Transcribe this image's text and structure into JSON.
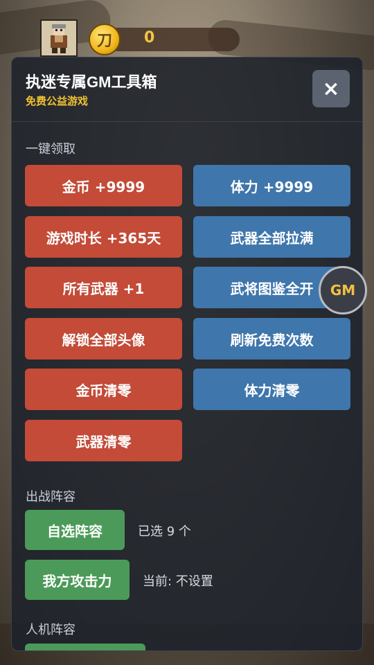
{
  "hud": {
    "coin_icon_glyph": "刀",
    "coin_value": "0"
  },
  "panel": {
    "title": "执迷专属GM工具箱",
    "subtitle": "免费公益游戏",
    "close_label": "×"
  },
  "section_one_click": {
    "title": "一键领取",
    "buttons": [
      {
        "label": "金币 +9999",
        "color": "#c34b38"
      },
      {
        "label": "体力 +9999",
        "color": "#3f76ac"
      },
      {
        "label": "游戏时长 +365天",
        "color": "#c34b38"
      },
      {
        "label": "武器全部拉满",
        "color": "#3f76ac"
      },
      {
        "label": "所有武器 +1",
        "color": "#c34b38"
      },
      {
        "label": "武将图鉴全开",
        "color": "#3f76ac"
      },
      {
        "label": "解锁全部头像",
        "color": "#c34b38"
      },
      {
        "label": "刷新免费次数",
        "color": "#3f76ac"
      },
      {
        "label": "金币清零",
        "color": "#c34b38"
      },
      {
        "label": "体力清零",
        "color": "#3f76ac"
      },
      {
        "label": "武器清零",
        "color": "#c34b38"
      }
    ]
  },
  "section_battle": {
    "title": "出战阵容",
    "select_lineup_label": "自选阵容",
    "selected_count_text": "已选 9 个",
    "attack_label": "我方攻击力",
    "attack_status_text": "当前: 不设置"
  },
  "section_ai": {
    "title": "人机阵容"
  },
  "gm_float": {
    "label": "GM"
  }
}
